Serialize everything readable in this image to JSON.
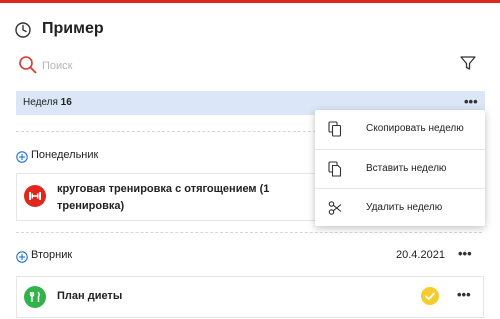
{
  "colors": {
    "accent": "#e1261c",
    "link": "#1e6fd9",
    "week_bg": "#dbe6f7",
    "badge_red": "#e1261c",
    "badge_green": "#31b24a",
    "check": "#f5cc2e"
  },
  "header": {
    "title": "Пример",
    "icon": "history-icon"
  },
  "search": {
    "placeholder": "Поиск",
    "value": "",
    "filter_icon": "filter-icon"
  },
  "week": {
    "prefix": "Неделя",
    "number": "16",
    "more": "•••"
  },
  "menu": {
    "items": [
      {
        "label": "Скопировать неделю",
        "icon": "copy-icon"
      },
      {
        "label": "Вставить неделю",
        "icon": "paste-icon"
      },
      {
        "label": "Удалить неделю",
        "icon": "scissors-icon"
      }
    ]
  },
  "days": [
    {
      "label": "Понедельник",
      "card": {
        "text_line1": "круговая тренировка с отягощением (1",
        "text_line2": "тренировка)",
        "icon": "dumbbell-icon"
      }
    },
    {
      "label": "Вторник",
      "date": "20.4.2021",
      "more": "•••",
      "card": {
        "text_line1": "План диеты",
        "icon": "fork-knife-icon",
        "more": "•••"
      }
    }
  ]
}
